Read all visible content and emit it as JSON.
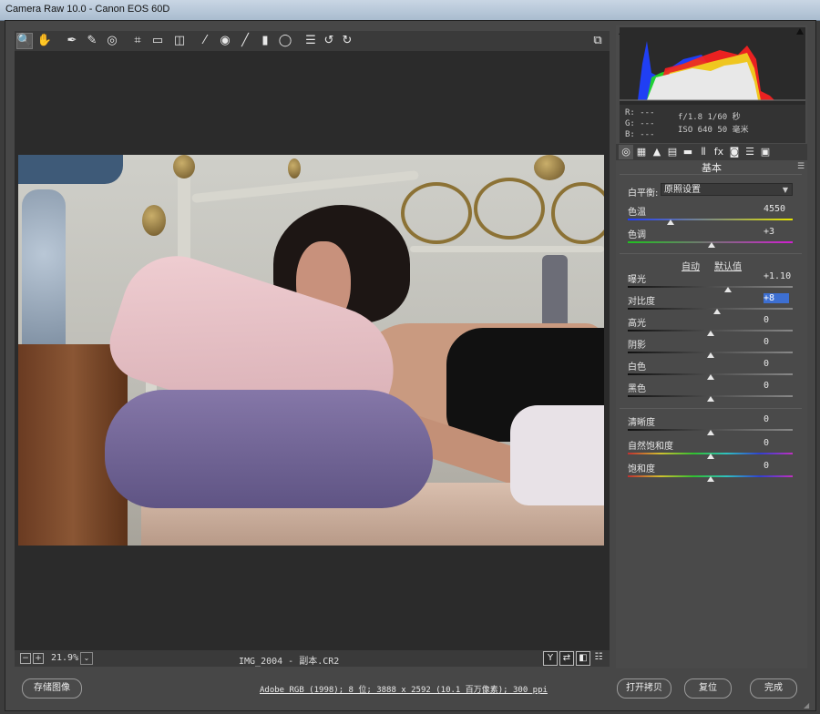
{
  "window": {
    "title": "Camera Raw 10.0 - Canon EOS 60D"
  },
  "toolbar": {
    "tools": [
      {
        "name": "zoom-tool",
        "icon": "magnifier-icon",
        "glyph": "🔍"
      },
      {
        "name": "hand-tool",
        "icon": "hand-icon",
        "glyph": "✋"
      },
      {
        "name": "white-balance-tool",
        "icon": "eyedropper-icon",
        "glyph": "✒"
      },
      {
        "name": "color-sampler-tool",
        "icon": "color-sampler-icon",
        "glyph": "✎"
      },
      {
        "name": "targeted-adjustment-tool",
        "icon": "target-icon",
        "glyph": "◎"
      },
      {
        "name": "crop-tool",
        "icon": "crop-icon",
        "glyph": "⌗"
      },
      {
        "name": "straighten-tool",
        "icon": "level-icon",
        "glyph": "▭"
      },
      {
        "name": "transform-tool",
        "icon": "transform-icon",
        "glyph": "◫"
      },
      {
        "name": "spot-removal-tool",
        "icon": "brush-heal-icon",
        "glyph": "⁄"
      },
      {
        "name": "red-eye-tool",
        "icon": "eye-icon",
        "glyph": "◉"
      },
      {
        "name": "adjustment-brush-tool",
        "icon": "brush-icon",
        "glyph": "╱"
      },
      {
        "name": "graduated-filter-tool",
        "icon": "gradient-icon",
        "glyph": "▮"
      },
      {
        "name": "radial-filter-tool",
        "icon": "ellipse-icon",
        "glyph": "◯"
      },
      {
        "name": "preferences-tool",
        "icon": "list-icon",
        "glyph": "☰"
      },
      {
        "name": "rotate-left-tool",
        "icon": "rotate-ccw-icon",
        "glyph": "↺"
      },
      {
        "name": "rotate-right-tool",
        "icon": "rotate-cw-icon",
        "glyph": "↻"
      }
    ],
    "fullscreen_glyph": "⧉"
  },
  "canvas": {
    "zoom": "21.9%",
    "zoom_minus": "−",
    "zoom_plus": "+",
    "dropdown_glyph": "⌄",
    "filename": "IMG_2004 - 副本.CR2",
    "view_buttons": [
      {
        "name": "before-after-y-button",
        "glyph": "Y"
      },
      {
        "name": "swap-before-after-button",
        "glyph": "⇄"
      },
      {
        "name": "copy-settings-button",
        "glyph": "◧"
      },
      {
        "name": "toggle-defaults-button",
        "glyph": "☷"
      }
    ]
  },
  "histogram": {
    "colors": {
      "red": "#ff2020",
      "green": "#20e020",
      "blue": "#2040ff",
      "yellow": "#f0f020",
      "white": "#e8e8e8"
    }
  },
  "readouts": {
    "r": "R:  ---",
    "g": "G:  ---",
    "b": "B:  ---",
    "aperture_shutter": "f/1.8   1/60 秒",
    "iso_focal": "ISO 640   50 毫米"
  },
  "panel_tabs": [
    {
      "name": "tab-basic",
      "glyph": "◎"
    },
    {
      "name": "tab-tone-curve",
      "glyph": "▦"
    },
    {
      "name": "tab-detail",
      "glyph": "▲"
    },
    {
      "name": "tab-hsl",
      "glyph": "▤"
    },
    {
      "name": "tab-split-toning",
      "glyph": "▬"
    },
    {
      "name": "tab-lens-corrections",
      "glyph": "⦀"
    },
    {
      "name": "tab-effects",
      "glyph": "fx"
    },
    {
      "name": "tab-camera-calibration",
      "glyph": "◙"
    },
    {
      "name": "tab-presets",
      "glyph": "☰"
    },
    {
      "name": "tab-snapshots",
      "glyph": "▣"
    }
  ],
  "basic": {
    "title": "基本",
    "white_balance_label": "白平衡:",
    "white_balance_value": "原照设置",
    "auto_label": "自动",
    "default_label": "默认值",
    "sliders": [
      {
        "key": "temp",
        "label": "色温",
        "value": "4550",
        "pos": 0.26,
        "track": "temp"
      },
      {
        "key": "tint",
        "label": "色调",
        "value": "+3",
        "pos": 0.51,
        "track": "tint"
      },
      {
        "key": "exposure",
        "label": "曝光",
        "value": "+1.10",
        "pos": 0.61,
        "track": "gray"
      },
      {
        "key": "contrast",
        "label": "对比度",
        "value": "+8",
        "pos": 0.54,
        "track": "gray",
        "selected": true
      },
      {
        "key": "highlights",
        "label": "高光",
        "value": "0",
        "pos": 0.5,
        "track": "gray"
      },
      {
        "key": "shadows",
        "label": "阴影",
        "value": "0",
        "pos": 0.5,
        "track": "gray"
      },
      {
        "key": "whites",
        "label": "白色",
        "value": "0",
        "pos": 0.5,
        "track": "gray"
      },
      {
        "key": "blacks",
        "label": "黑色",
        "value": "0",
        "pos": 0.5,
        "track": "gray"
      },
      {
        "key": "clarity",
        "label": "清晰度",
        "value": "0",
        "pos": 0.5,
        "track": "gray"
      },
      {
        "key": "vibrance",
        "label": "自然饱和度",
        "value": "0",
        "pos": 0.5,
        "track": "rainbow"
      },
      {
        "key": "saturation",
        "label": "饱和度",
        "value": "0",
        "pos": 0.5,
        "track": "rainbow"
      }
    ]
  },
  "footer": {
    "save_label": "存储图像",
    "workflow_info": "Adobe RGB (1998); 8 位; 3888 x 2592 (10.1 百万像素); 300 ppi",
    "open_copy_label": "打开拷贝",
    "reset_label": "复位",
    "done_label": "完成"
  }
}
